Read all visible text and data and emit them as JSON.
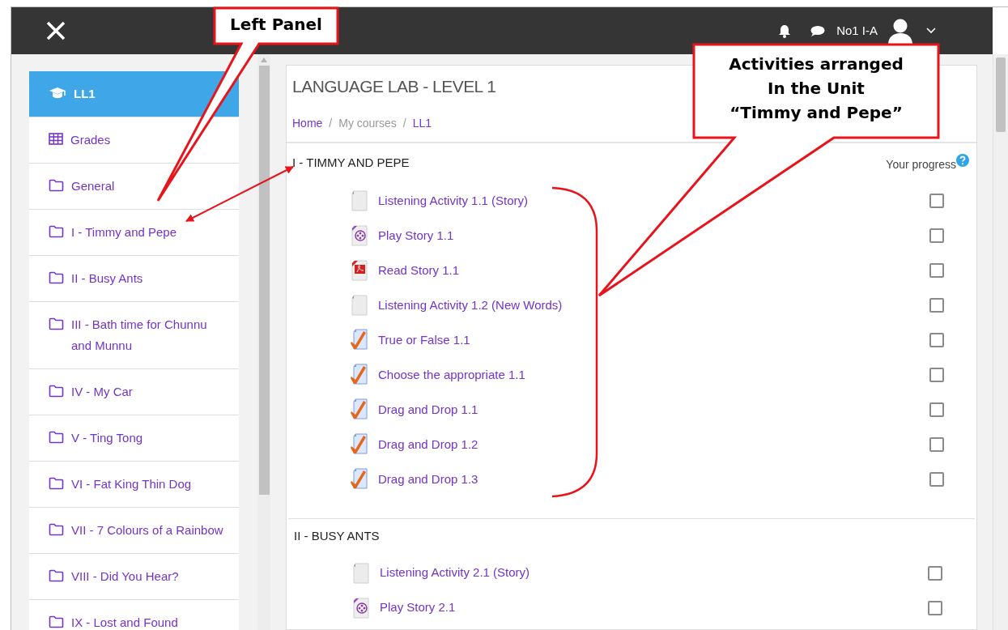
{
  "top_bar": {
    "user_name": "No1 I-A"
  },
  "sidebar": {
    "items": [
      {
        "label": "LL1",
        "kind": "course",
        "selected": true
      },
      {
        "label": "Grades",
        "kind": "grades",
        "selected": false
      },
      {
        "label": "General",
        "kind": "folder",
        "selected": false
      },
      {
        "label": "I - Timmy and Pepe",
        "kind": "folder",
        "selected": false
      },
      {
        "label": "II - Busy Ants",
        "kind": "folder",
        "selected": false
      },
      {
        "label": "III - Bath time for Chunnu and Munnu",
        "kind": "folder",
        "selected": false
      },
      {
        "label": "IV - My Car",
        "kind": "folder",
        "selected": false
      },
      {
        "label": "V - Ting Tong",
        "kind": "folder",
        "selected": false
      },
      {
        "label": "VI - Fat King Thin Dog",
        "kind": "folder",
        "selected": false
      },
      {
        "label": "VII - 7 Colours of a Rainbow",
        "kind": "folder",
        "selected": false
      },
      {
        "label": "VIII - Did You Hear?",
        "kind": "folder",
        "selected": false
      },
      {
        "label": "IX - Lost and Found",
        "kind": "folder",
        "selected": false
      }
    ]
  },
  "page": {
    "title": "LANGUAGE LAB - LEVEL 1",
    "breadcrumb": [
      "Home",
      "My courses",
      "LL1"
    ],
    "separator": "/"
  },
  "sections": [
    {
      "title": "I - TIMMY AND PEPE",
      "progress_label": "Your progress",
      "activities": [
        {
          "title": "Listening Activity 1.1 (Story)",
          "kind": "audio",
          "checked": false
        },
        {
          "title": "Play Story 1.1",
          "kind": "video",
          "checked": false
        },
        {
          "title": "Read Story 1.1",
          "kind": "pdf",
          "checked": false
        },
        {
          "title": "Listening Activity 1.2 (New Words)",
          "kind": "audio",
          "checked": false
        },
        {
          "title": "True or False 1.1",
          "kind": "quiz",
          "checked": false
        },
        {
          "title": "Choose the appropriate 1.1",
          "kind": "quiz",
          "checked": false
        },
        {
          "title": "Drag and Drop 1.1",
          "kind": "quiz",
          "checked": false
        },
        {
          "title": "Drag and Drop 1.2",
          "kind": "quiz",
          "checked": false
        },
        {
          "title": "Drag and Drop 1.3",
          "kind": "quiz",
          "checked": false
        }
      ]
    },
    {
      "title": "II - BUSY ANTS",
      "activities": [
        {
          "title": "Listening Activity 2.1 (Story)",
          "kind": "audio",
          "checked": false
        },
        {
          "title": "Play Story 2.1",
          "kind": "video",
          "checked": false
        }
      ]
    }
  ],
  "annotations": [
    {
      "lines": [
        "Left Panel"
      ]
    },
    {
      "lines": [
        "Activities arranged",
        "In the Unit",
        "“Timmy and Pepe”"
      ]
    }
  ]
}
